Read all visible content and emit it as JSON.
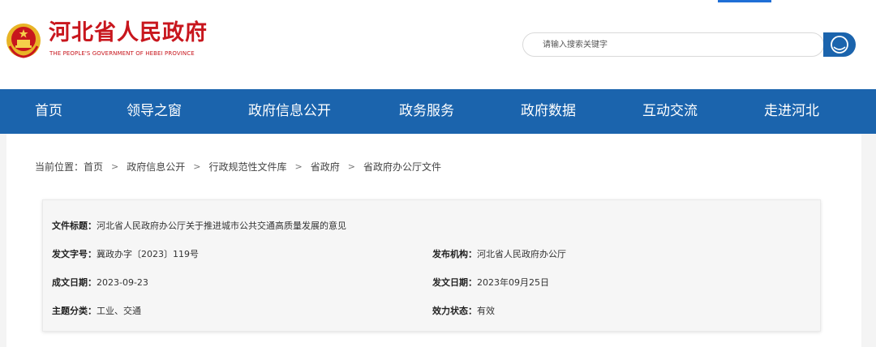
{
  "header": {
    "brand_cn": "河北省人民政府",
    "brand_en": "THE PEOPLE'S GOVERNMENT OF HEBEI PROVINCE",
    "emblem_icon": "national-emblem-icon",
    "search_placeholder": "请输入搜索关键字",
    "search_icon": "search-icon"
  },
  "colors": {
    "brand_red": "#c8161d",
    "nav_blue": "#1b64ad",
    "emblem_gold": "#e8b426"
  },
  "nav": {
    "items": [
      {
        "label": "首页"
      },
      {
        "label": "领导之窗"
      },
      {
        "label": "政府信息公开"
      },
      {
        "label": "政务服务"
      },
      {
        "label": "政府数据"
      },
      {
        "label": "互动交流"
      },
      {
        "label": "走进河北"
      }
    ]
  },
  "breadcrumb": {
    "prefix": "当前位置：",
    "separator": ">",
    "items": [
      "首页",
      "政府信息公开",
      "行政规范性文件库",
      "省政府",
      "省政府办公厅文件"
    ]
  },
  "document": {
    "title_key": "文件标题：",
    "title_val": "河北省人民政府办公厅关于推进城市公共交通高质量发展的意见",
    "number_key": "发文字号：",
    "number_val": "冀政办字〔2023〕119号",
    "issuer_key": "发布机构：",
    "issuer_val": "河北省人民政府办公厅",
    "written_key": "成文日期：",
    "written_val": "2023-09-23",
    "issued_key": "发文日期：",
    "issued_val": "2023年09月25日",
    "topic_key": "主题分类：",
    "topic_val": "工业、交通",
    "status_key": "效力状态：",
    "status_val": "有效"
  }
}
